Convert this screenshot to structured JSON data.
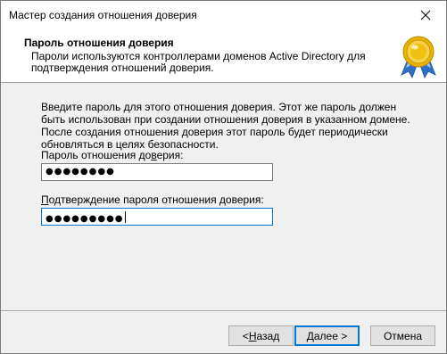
{
  "window": {
    "title": "Мастер создания отношения доверия",
    "close_glyph": "✕"
  },
  "header": {
    "title": "Пароль отношения доверия",
    "description": "Пароли используются контроллерами доменов Active Directory для подтверждения отношений доверия.",
    "icon": "award-seal-icon"
  },
  "content": {
    "instructions": "Введите пароль для этого отношения доверия. Этот же пароль должен быть использован при создании отношения доверия в указанном домене. После создания отношения доверия этот пароль будет периодически обновляться в целях безопасности.",
    "password": {
      "label_pre": "Пароль отношения до",
      "label_accel": "в",
      "label_post": "ерия:",
      "masked_value": "●●●●●●●●"
    },
    "confirm": {
      "label_accel": "П",
      "label_post": "одтверждение пароля отношения доверия:",
      "masked_value": "●●●●●●●●●"
    }
  },
  "buttons": {
    "back": {
      "prefix": "< ",
      "accel": "Н",
      "rest": "азад"
    },
    "next": {
      "accel": "Д",
      "rest": "алее >"
    },
    "cancel": {
      "label": "Отмена"
    }
  },
  "colors": {
    "focus_accent": "#0078d7",
    "seal_gold": "#e8b400",
    "ribbon_blue": "#2f6fc9"
  }
}
